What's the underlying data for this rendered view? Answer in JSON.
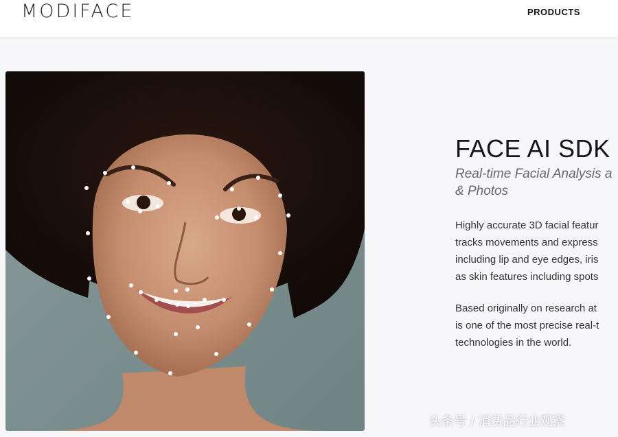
{
  "header": {
    "logo": "MODIFACE",
    "nav_products": "PRODUCTS"
  },
  "hero": {
    "title": "FACE AI SDK",
    "subtitle_line1": "Real-time Facial Analysis a",
    "subtitle_line2": "& Photos",
    "para1": [
      "Highly accurate 3D facial featur",
      "tracks movements and express",
      "including lip and eye edges, iris",
      "as skin features including spots"
    ],
    "para2": [
      "Based originally on research at",
      "is one of the most precise real-t",
      "technologies in the world."
    ]
  },
  "watermark": "头条号 / 消费品行业观察"
}
